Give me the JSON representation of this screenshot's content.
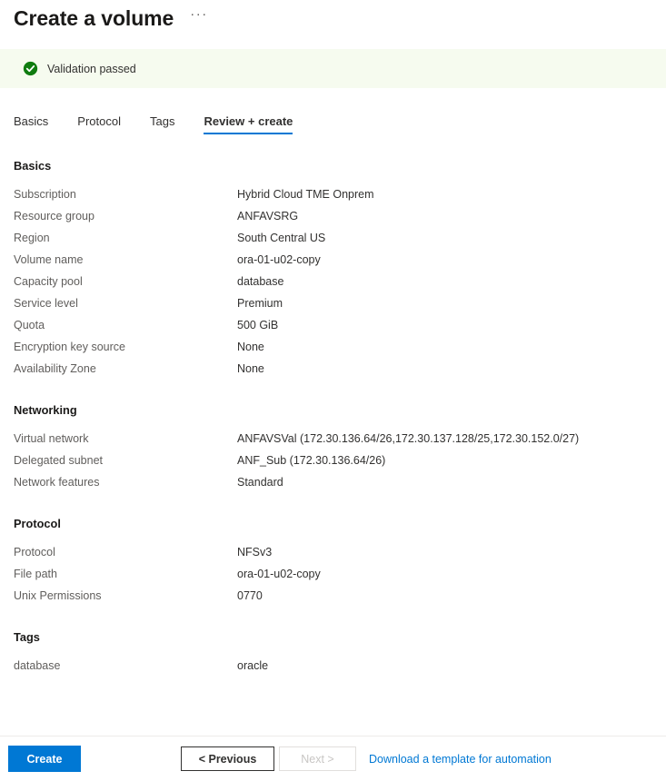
{
  "header": {
    "title": "Create a volume",
    "ellipsis_label": "···"
  },
  "validation": {
    "text": "Validation passed",
    "icon": "check-circle-icon",
    "banner_color": "#f6fbef",
    "icon_color": "#107c10"
  },
  "tabs": [
    {
      "label": "Basics",
      "active": false
    },
    {
      "label": "Protocol",
      "active": false
    },
    {
      "label": "Tags",
      "active": false
    },
    {
      "label": "Review + create",
      "active": true
    }
  ],
  "sections": [
    {
      "title": "Basics",
      "rows": [
        {
          "label": "Subscription",
          "value": "Hybrid Cloud TME Onprem"
        },
        {
          "label": "Resource group",
          "value": "ANFAVSRG"
        },
        {
          "label": "Region",
          "value": "South Central US"
        },
        {
          "label": "Volume name",
          "value": "ora-01-u02-copy"
        },
        {
          "label": "Capacity pool",
          "value": "database"
        },
        {
          "label": "Service level",
          "value": "Premium"
        },
        {
          "label": "Quota",
          "value": "500 GiB"
        },
        {
          "label": "Encryption key source",
          "value": "None"
        },
        {
          "label": "Availability Zone",
          "value": "None"
        }
      ]
    },
    {
      "title": "Networking",
      "rows": [
        {
          "label": "Virtual network",
          "value": "ANFAVSVal (172.30.136.64/26,172.30.137.128/25,172.30.152.0/27)"
        },
        {
          "label": "Delegated subnet",
          "value": "ANF_Sub (172.30.136.64/26)"
        },
        {
          "label": "Network features",
          "value": "Standard"
        }
      ]
    },
    {
      "title": "Protocol",
      "rows": [
        {
          "label": "Protocol",
          "value": "NFSv3"
        },
        {
          "label": "File path",
          "value": "ora-01-u02-copy"
        },
        {
          "label": "Unix Permissions",
          "value": "0770"
        }
      ]
    },
    {
      "title": "Tags",
      "rows": [
        {
          "label": "database",
          "value": "oracle"
        }
      ]
    }
  ],
  "footer": {
    "create_label": "Create",
    "previous_label": "< Previous",
    "next_label": "Next >",
    "next_disabled": true,
    "template_link_label": "Download a template for automation",
    "accent_color": "#0078d4"
  }
}
